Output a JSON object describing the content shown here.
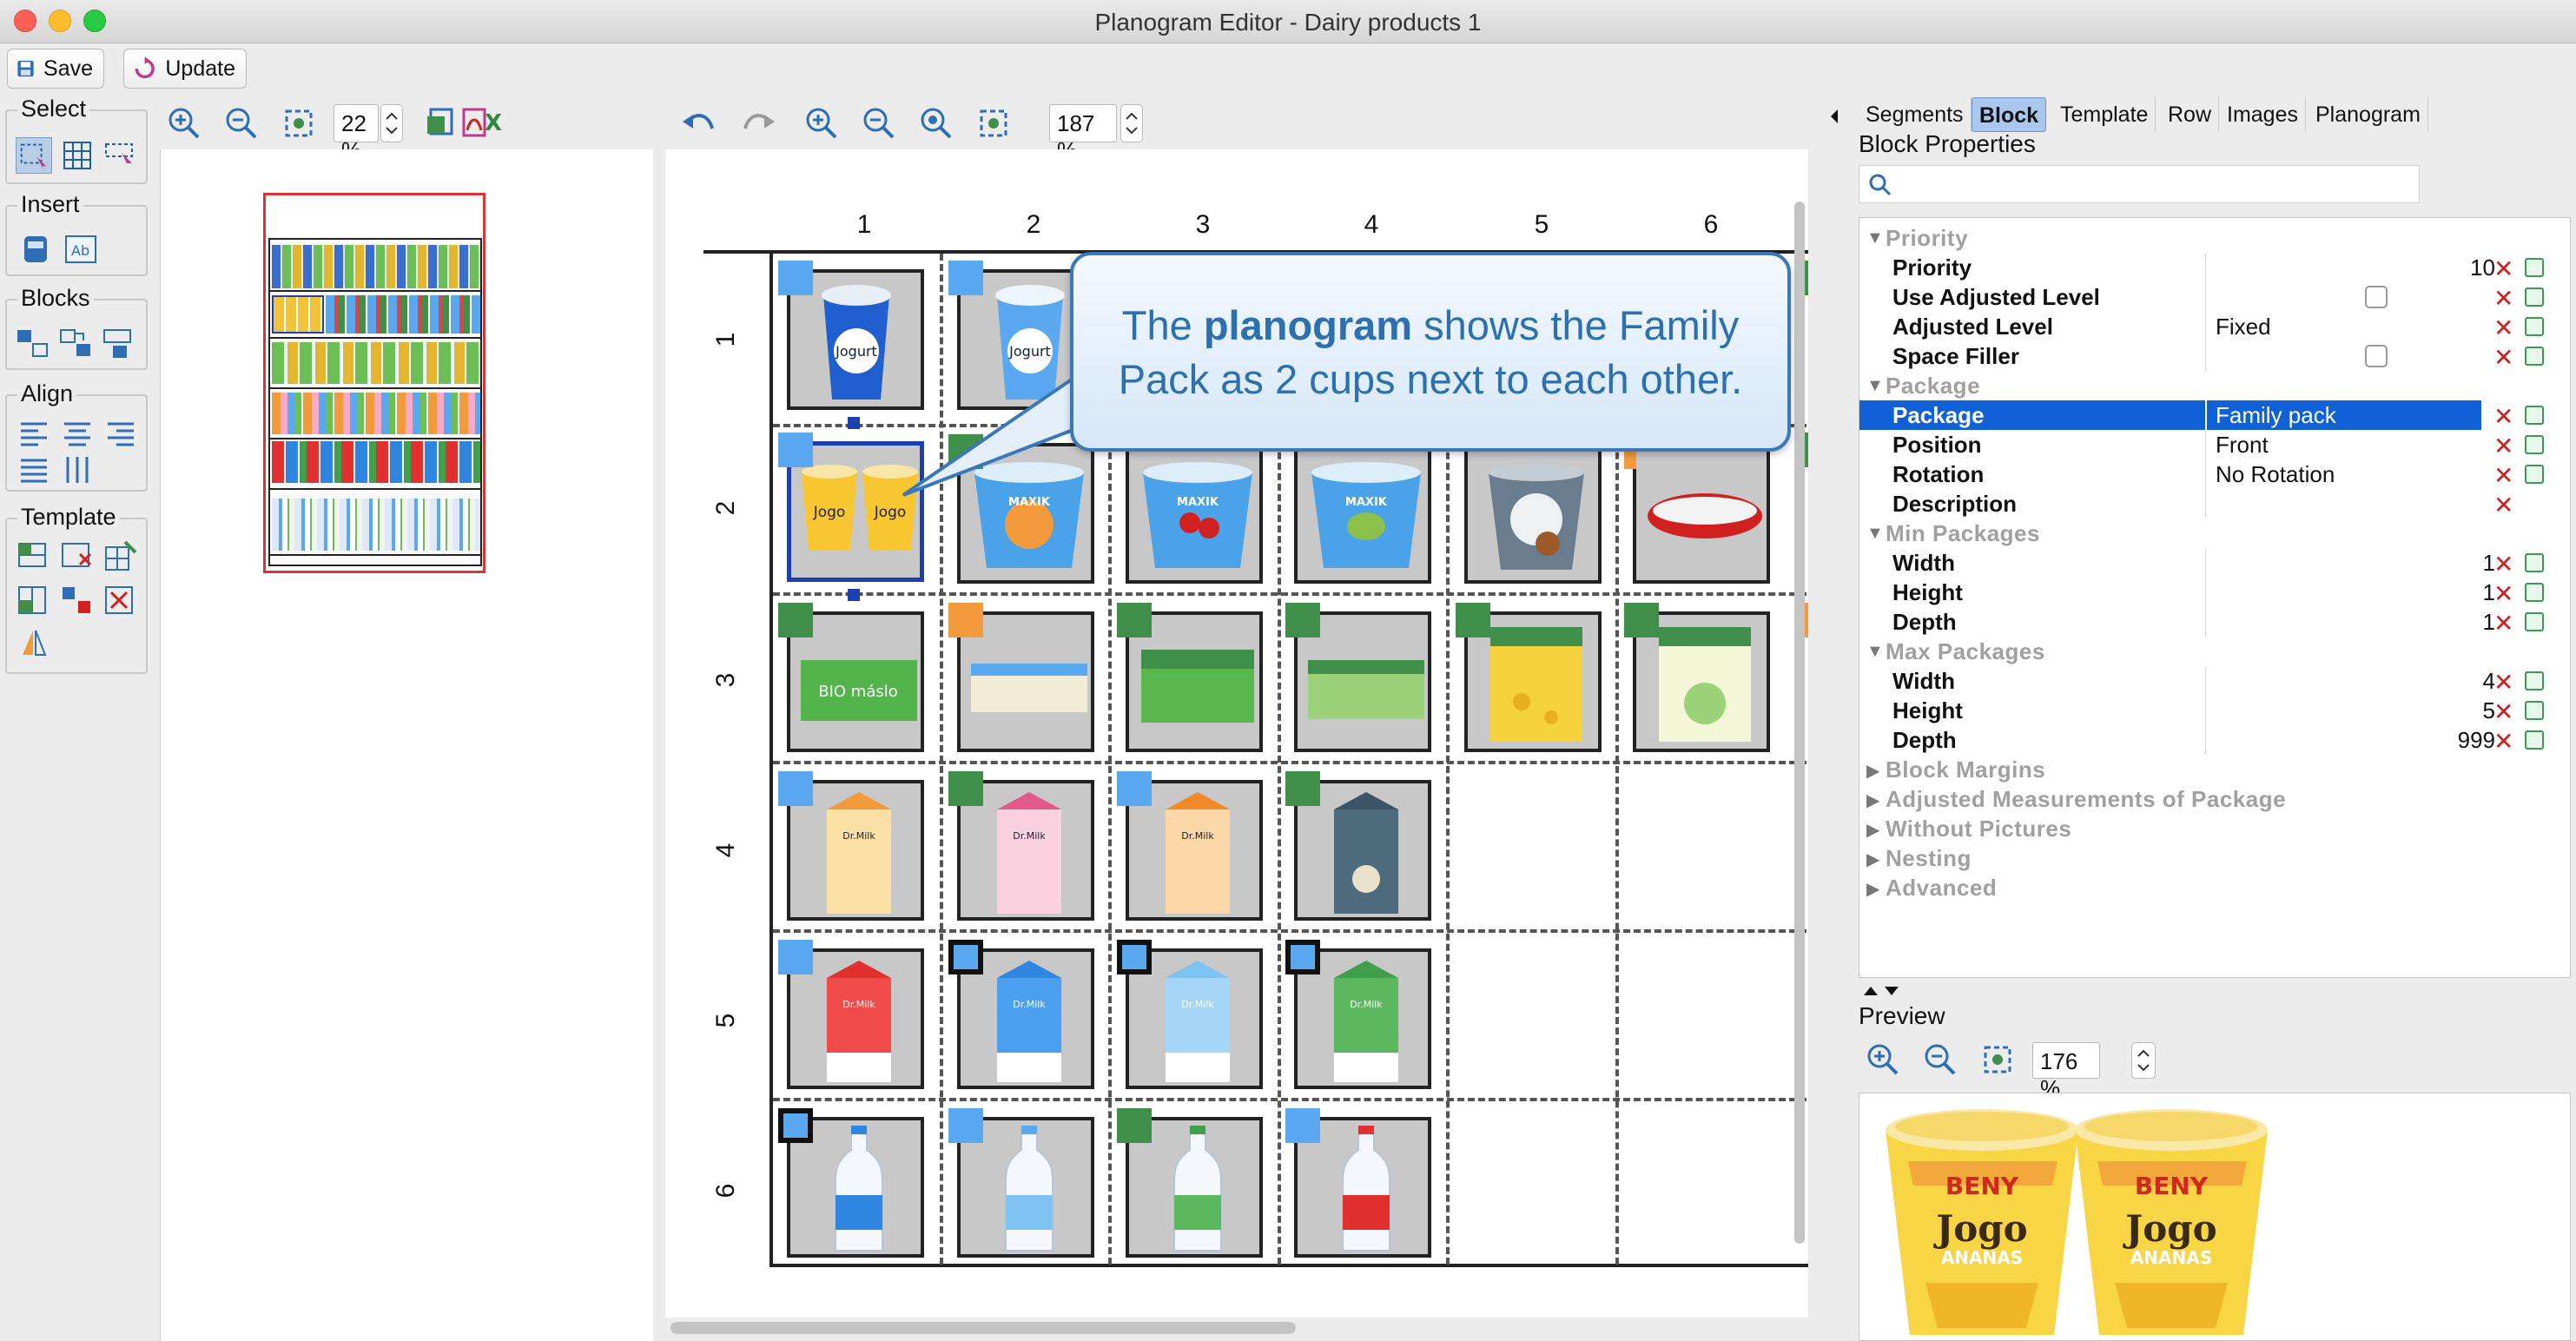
{
  "window": {
    "title": "Planogram Editor - Dairy products 1"
  },
  "toolbar": {
    "save_label": "Save",
    "update_label": "Update"
  },
  "palette": {
    "select_label": "Select",
    "insert_label": "Insert",
    "blocks_label": "Blocks",
    "align_label": "Align",
    "template_label": "Template"
  },
  "overview": {
    "zoom": "22 %"
  },
  "editor": {
    "zoom": "187 %",
    "columns": [
      "1",
      "2",
      "3",
      "4",
      "5",
      "6"
    ],
    "rows": [
      "1",
      "2",
      "3",
      "4",
      "5",
      "6"
    ]
  },
  "callout": {
    "pre": "The ",
    "bold": "planogram",
    "post": " shows the Family Pack as 2 cups next to each other."
  },
  "right": {
    "tabs": [
      "Segments",
      "Block",
      "Template",
      "Row",
      "Images",
      "Planogram"
    ],
    "active_tab": "Block",
    "block_properties_title": "Block Properties",
    "search_placeholder": "",
    "categories": {
      "priority": "Priority",
      "package": "Package",
      "min_packages": "Min Packages",
      "max_packages": "Max Packages",
      "block_margins": "Block Margins",
      "adjusted_measurements": "Adjusted Measurements of Package",
      "without_pictures": "Without Pictures",
      "nesting": "Nesting",
      "advanced": "Advanced"
    },
    "props": {
      "priority": {
        "name": "Priority",
        "value": "10"
      },
      "use_adjusted_level": {
        "name": "Use Adjusted Level"
      },
      "adjusted_level": {
        "name": "Adjusted Level",
        "value": "Fixed"
      },
      "space_filler": {
        "name": "Space Filler"
      },
      "package": {
        "name": "Package",
        "value": "Family pack"
      },
      "position": {
        "name": "Position",
        "value": "Front"
      },
      "rotation": {
        "name": "Rotation",
        "value": "No Rotation"
      },
      "description": {
        "name": "Description",
        "value": ""
      },
      "min_width": {
        "name": "Width",
        "value": "1"
      },
      "min_height": {
        "name": "Height",
        "value": "1"
      },
      "min_depth": {
        "name": "Depth",
        "value": "1"
      },
      "max_width": {
        "name": "Width",
        "value": "4"
      },
      "max_height": {
        "name": "Height",
        "value": "5"
      },
      "max_depth": {
        "name": "Depth",
        "value": "999"
      }
    },
    "preview_title": "Preview",
    "preview_zoom": "176 %"
  },
  "products": {
    "jogurt": "Jogurt",
    "jogo": "Jogo",
    "ananas": "ANANAS",
    "beny": "BENY",
    "drmilk": "Dr.Milk",
    "maxik": "MAXIK",
    "bio_maslo": "BIO máslo"
  },
  "colors": {
    "marker_blue": "#5aa8f0",
    "marker_green": "#3f8f4a",
    "marker_orange": "#f29a3c",
    "selection": "#1060d8",
    "callout_text": "#2e6fb0"
  }
}
